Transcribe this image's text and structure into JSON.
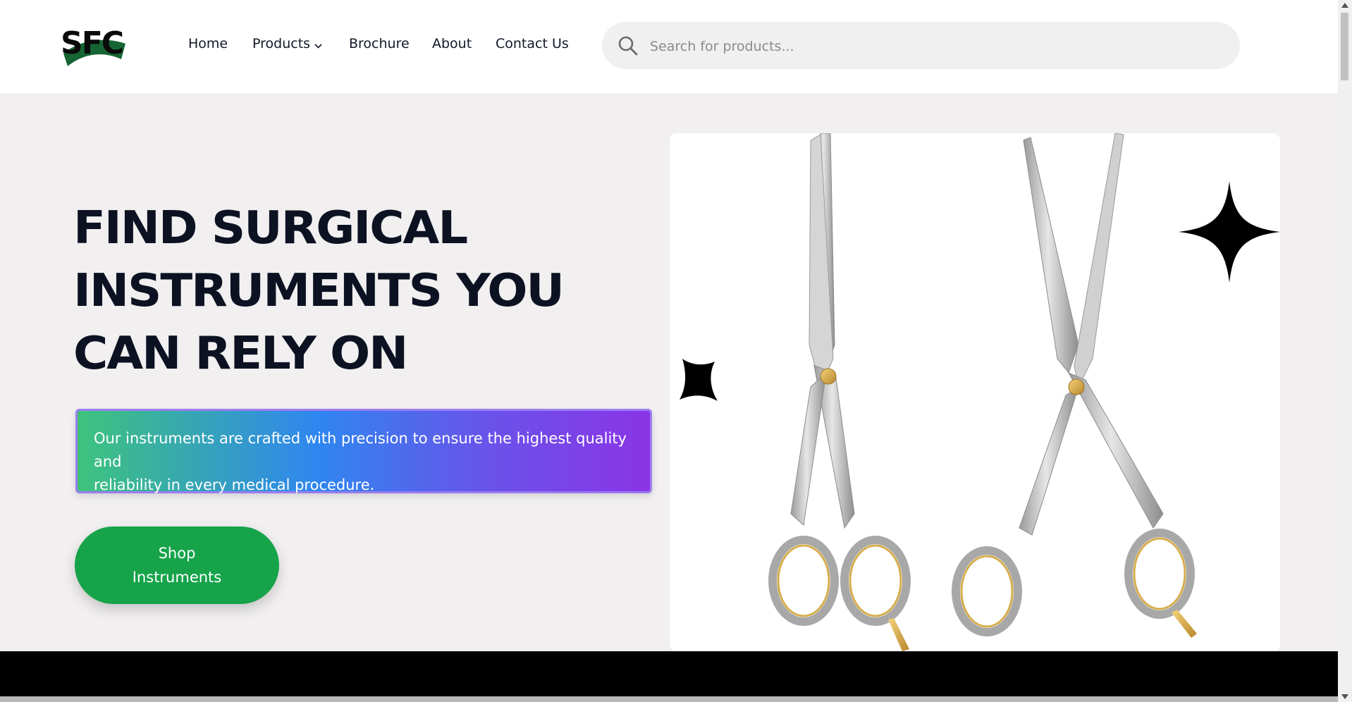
{
  "header": {
    "logo_text": "SFC",
    "nav": [
      {
        "label": "Home"
      },
      {
        "label": "Products",
        "has_dropdown": true
      },
      {
        "label": "Brochure"
      },
      {
        "label": "About"
      },
      {
        "label": "Contact Us"
      }
    ],
    "search": {
      "placeholder": "Search for products...",
      "value": ""
    }
  },
  "hero": {
    "title_lines": [
      "FIND SURGICAL",
      "INSTRUMENTS YOU",
      "CAN RELY ON"
    ],
    "description_line1": "Our instruments are crafted with precision to ensure the highest quality and",
    "description_line2": "reliability in every medical procedure.",
    "cta_line1": "Shop",
    "cta_line2": "Instruments"
  },
  "colors": {
    "page_bg": "#f1eff0",
    "title": "#0c1222",
    "cta": "#16a34a",
    "gradient": [
      "#3ec47b",
      "#2f86f0",
      "#6a52ea",
      "#8b34e6"
    ],
    "footer": "#000000"
  },
  "icons": {
    "search": "search-icon",
    "dropdown": "chevron-down-icon",
    "sparkle": "sparkle-icon"
  }
}
